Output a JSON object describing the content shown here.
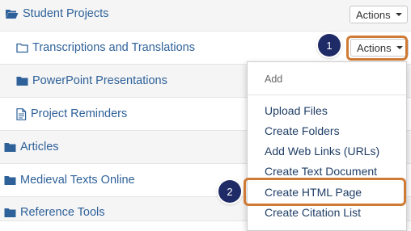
{
  "rows": [
    {
      "label": "Student Projects",
      "icon": "folder-open-icon",
      "actions_label": "Actions"
    },
    {
      "label": "Transcriptions and Translations",
      "icon": "folder-outline-icon",
      "actions_label": "Actions"
    },
    {
      "label": "PowerPoint Presentations",
      "icon": "folder-icon"
    },
    {
      "label": "Project Reminders",
      "icon": "document-icon"
    },
    {
      "label": "Articles",
      "icon": "folder-icon"
    },
    {
      "label": "Medieval Texts Online",
      "icon": "folder-icon"
    },
    {
      "label": "Reference Tools",
      "icon": "folder-icon"
    }
  ],
  "menu": {
    "header": "Add",
    "items": [
      "Upload Files",
      "Create Folders",
      "Add Web Links (URLs)",
      "Create Text Document",
      "Create HTML Page",
      "Create Citation List"
    ]
  },
  "callouts": {
    "step1": "1",
    "step2": "2"
  },
  "colors": {
    "link": "#2e6199",
    "highlight": "#cf7b35",
    "badge": "#1f2b66"
  }
}
